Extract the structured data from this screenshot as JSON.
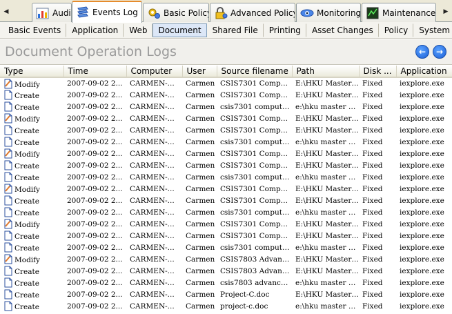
{
  "main_tabs": [
    {
      "label": "Audit",
      "icon": "chart-icon"
    },
    {
      "label": "Events Log",
      "icon": "log-stack-icon"
    },
    {
      "label": "Basic Policy",
      "icon": "policy-gear-icon"
    },
    {
      "label": "Advanced Policy",
      "icon": "lock-gear-icon"
    },
    {
      "label": "Monitoring",
      "icon": "monitor-eye-icon"
    },
    {
      "label": "Maintenance",
      "icon": "maintenance-screen-icon"
    }
  ],
  "active_main_tab": "Events Log",
  "sub_tabs": [
    "Basic Events",
    "Application",
    "Web",
    "Document",
    "Shared File",
    "Printing",
    "Asset Changes",
    "Policy",
    "System"
  ],
  "active_sub_tab": "Document",
  "page_title": "Document Operation Logs",
  "columns": [
    "Type",
    "Time",
    "Computer",
    "User",
    "Source filename",
    "Path",
    "Disk ...",
    "Application"
  ],
  "rows": [
    {
      "type": "Modify",
      "time": "2007-09-02 2...",
      "computer": "CARMEN-...",
      "user": "Carmen",
      "source": "CSIS7301 Compu...",
      "path": "E:\\HKU Master ...",
      "disk": "Fixed",
      "app": "iexplore.exe"
    },
    {
      "type": "Create",
      "time": "2007-09-02 2...",
      "computer": "CARMEN-...",
      "user": "Carmen",
      "source": "CSIS7301 Compu...",
      "path": "E:\\HKU Master ...",
      "disk": "Fixed",
      "app": "iexplore.exe"
    },
    {
      "type": "Create",
      "time": "2007-09-02 2...",
      "computer": "CARMEN-...",
      "user": "Carmen",
      "source": "csis7301 computer...",
      "path": "e:\\hku master co...",
      "disk": "Fixed",
      "app": "iexplore.exe"
    },
    {
      "type": "Modify",
      "time": "2007-09-02 2...",
      "computer": "CARMEN-...",
      "user": "Carmen",
      "source": "CSIS7301 Compu...",
      "path": "E:\\HKU Master ...",
      "disk": "Fixed",
      "app": "iexplore.exe"
    },
    {
      "type": "Create",
      "time": "2007-09-02 2...",
      "computer": "CARMEN-...",
      "user": "Carmen",
      "source": "CSIS7301 Compu...",
      "path": "E:\\HKU Master ...",
      "disk": "Fixed",
      "app": "iexplore.exe"
    },
    {
      "type": "Create",
      "time": "2007-09-02 2...",
      "computer": "CARMEN-...",
      "user": "Carmen",
      "source": "csis7301 computer...",
      "path": "e:\\hku master co...",
      "disk": "Fixed",
      "app": "iexplore.exe"
    },
    {
      "type": "Modify",
      "time": "2007-09-02 2...",
      "computer": "CARMEN-...",
      "user": "Carmen",
      "source": "CSIS7301 Compu...",
      "path": "E:\\HKU Master ...",
      "disk": "Fixed",
      "app": "iexplore.exe"
    },
    {
      "type": "Create",
      "time": "2007-09-02 2...",
      "computer": "CARMEN-...",
      "user": "Carmen",
      "source": "CSIS7301 Compu...",
      "path": "E:\\HKU Master ...",
      "disk": "Fixed",
      "app": "iexplore.exe"
    },
    {
      "type": "Create",
      "time": "2007-09-02 2...",
      "computer": "CARMEN-...",
      "user": "Carmen",
      "source": "csis7301 computer...",
      "path": "e:\\hku master co...",
      "disk": "Fixed",
      "app": "iexplore.exe"
    },
    {
      "type": "Modify",
      "time": "2007-09-02 2...",
      "computer": "CARMEN-...",
      "user": "Carmen",
      "source": "CSIS7301 Compu...",
      "path": "E:\\HKU Master ...",
      "disk": "Fixed",
      "app": "iexplore.exe"
    },
    {
      "type": "Create",
      "time": "2007-09-02 2...",
      "computer": "CARMEN-...",
      "user": "Carmen",
      "source": "CSIS7301 Compu...",
      "path": "E:\\HKU Master ...",
      "disk": "Fixed",
      "app": "iexplore.exe"
    },
    {
      "type": "Create",
      "time": "2007-09-02 2...",
      "computer": "CARMEN-...",
      "user": "Carmen",
      "source": "csis7301 computer...",
      "path": "e:\\hku master co...",
      "disk": "Fixed",
      "app": "iexplore.exe"
    },
    {
      "type": "Modify",
      "time": "2007-09-02 2...",
      "computer": "CARMEN-...",
      "user": "Carmen",
      "source": "CSIS7301 Compu...",
      "path": "E:\\HKU Master ...",
      "disk": "Fixed",
      "app": "iexplore.exe"
    },
    {
      "type": "Create",
      "time": "2007-09-02 2...",
      "computer": "CARMEN-...",
      "user": "Carmen",
      "source": "CSIS7301 Compu...",
      "path": "E:\\HKU Master ...",
      "disk": "Fixed",
      "app": "iexplore.exe"
    },
    {
      "type": "Create",
      "time": "2007-09-02 2...",
      "computer": "CARMEN-...",
      "user": "Carmen",
      "source": "csis7301 computer...",
      "path": "e:\\hku master co...",
      "disk": "Fixed",
      "app": "iexplore.exe"
    },
    {
      "type": "Modify",
      "time": "2007-09-02 2...",
      "computer": "CARMEN-...",
      "user": "Carmen",
      "source": "CSIS7803 Advanc...",
      "path": "E:\\HKU Master ...",
      "disk": "Fixed",
      "app": "iexplore.exe"
    },
    {
      "type": "Create",
      "time": "2007-09-02 2...",
      "computer": "CARMEN-...",
      "user": "Carmen",
      "source": "CSIS7803 Advanc...",
      "path": "E:\\HKU Master ...",
      "disk": "Fixed",
      "app": "iexplore.exe"
    },
    {
      "type": "Create",
      "time": "2007-09-02 2...",
      "computer": "CARMEN-...",
      "user": "Carmen",
      "source": "csis7803 advanced...",
      "path": "e:\\hku master co...",
      "disk": "Fixed",
      "app": "iexplore.exe"
    },
    {
      "type": "Create",
      "time": "2007-09-02 2...",
      "computer": "CARMEN-...",
      "user": "Carmen",
      "source": "Project-C.doc",
      "path": "E:\\HKU Master ...",
      "disk": "Fixed",
      "app": "iexplore.exe"
    },
    {
      "type": "Create",
      "time": "2007-09-02 2...",
      "computer": "CARMEN-...",
      "user": "Carmen",
      "source": "project-c.doc",
      "path": "e:\\hku master co...",
      "disk": "Fixed",
      "app": "iexplore.exe"
    }
  ],
  "colors": {
    "accent_tab": "#e68b2c",
    "nav_button": "#1c5fd6",
    "title_text": "#9a9a9a"
  }
}
